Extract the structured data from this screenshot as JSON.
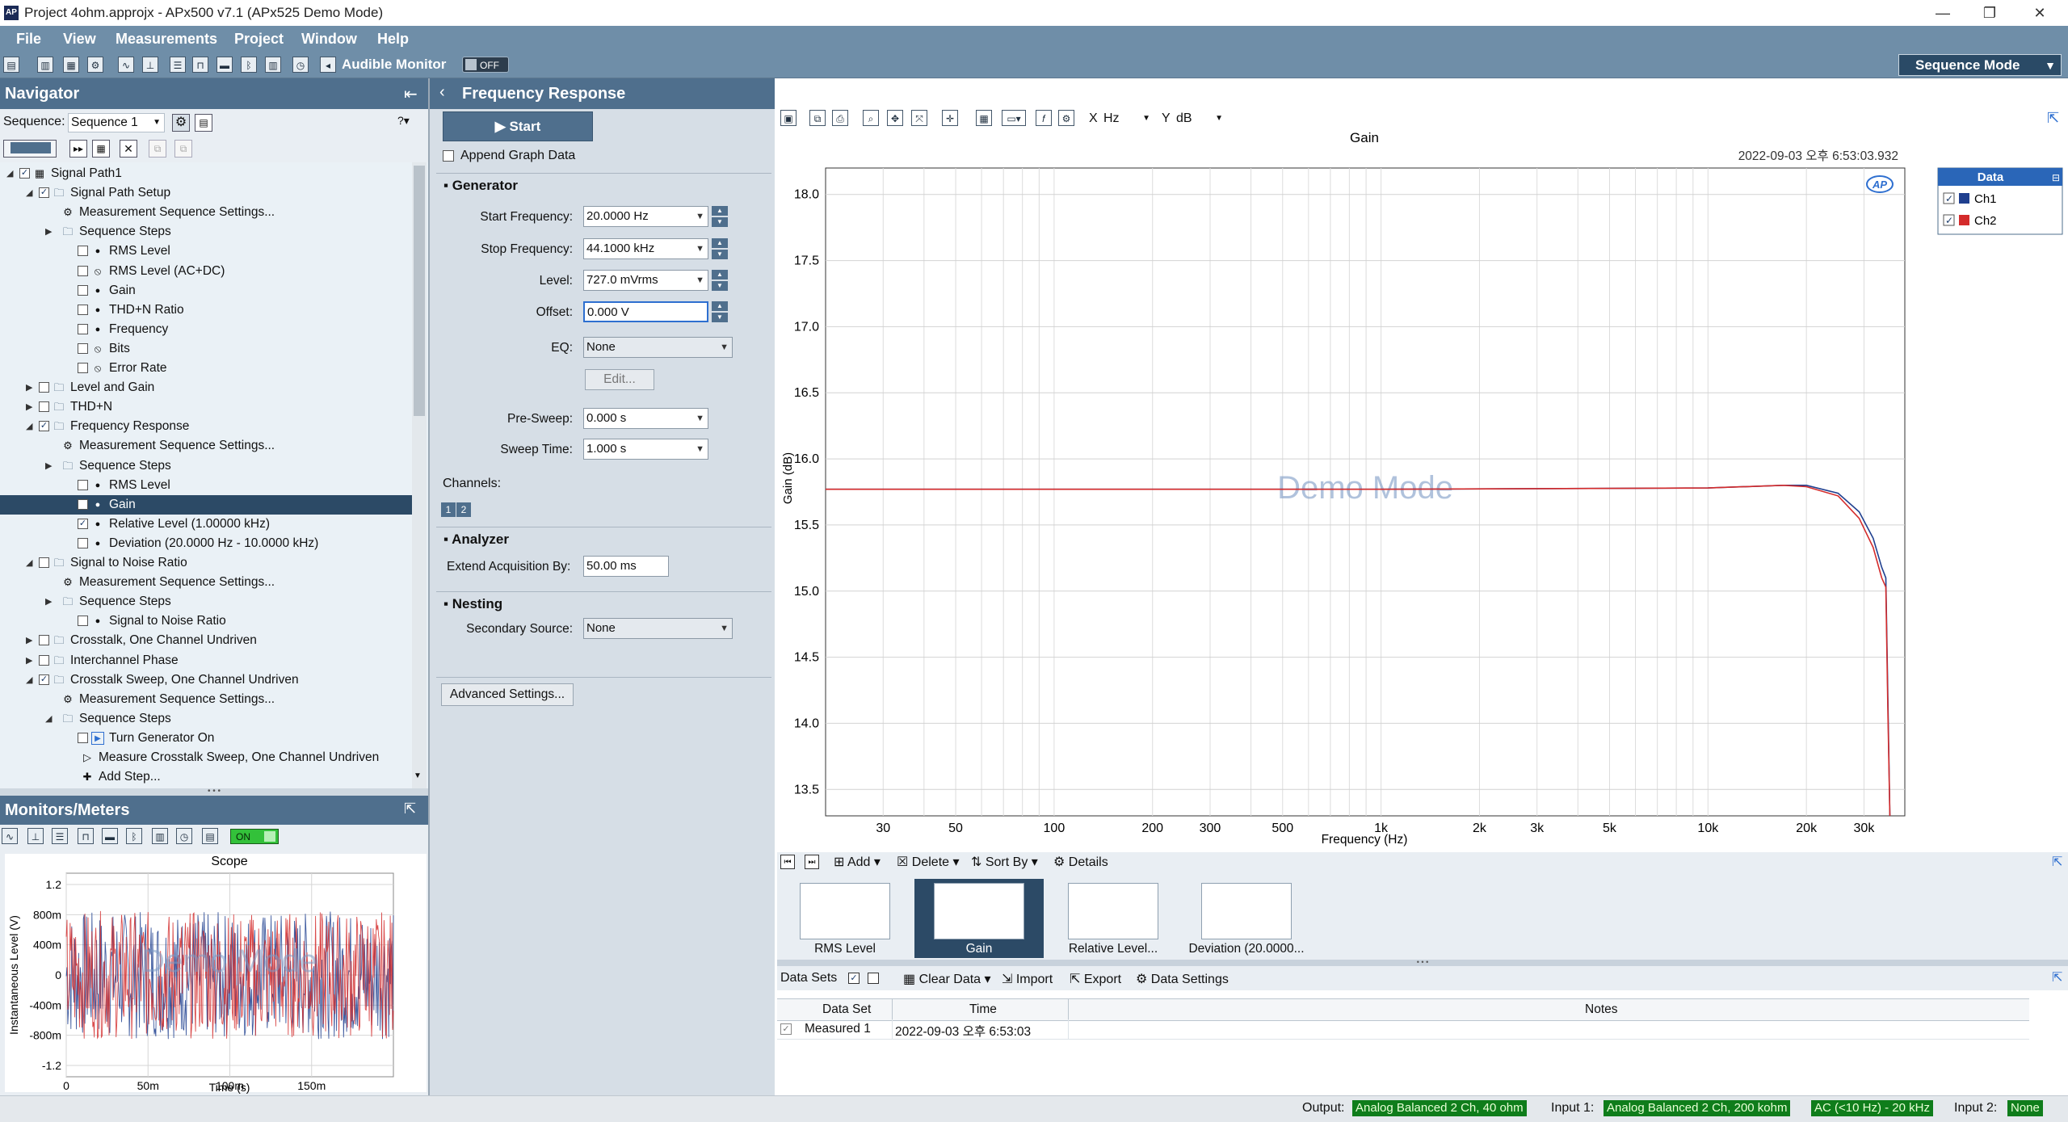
{
  "window": {
    "title": "Project 4ohm.approjx - APx500 v7.1 (APx525 Demo Mode)",
    "controls": [
      "minimize",
      "maximize",
      "close"
    ]
  },
  "menu": [
    "File",
    "View",
    "Measurements",
    "Project",
    "Window",
    "Help"
  ],
  "toolbar": {
    "audible_monitor_label": "Audible Monitor",
    "audible_monitor_state": "OFF",
    "sequence_mode": "Sequence Mode"
  },
  "navigator": {
    "title": "Navigator",
    "sequence_label": "Sequence:",
    "sequence_value": "Sequence 1",
    "tree": [
      {
        "label": "Signal Path1",
        "indent": 0,
        "twisty": "expanded",
        "checked": true,
        "icon": "signal-path-icon"
      },
      {
        "label": "Signal Path Setup",
        "indent": 1,
        "twisty": "expanded",
        "checked": true,
        "icon": "folder-icon"
      },
      {
        "label": "Measurement Sequence Settings...",
        "indent": 2,
        "twisty": "",
        "checked": null,
        "icon": "gear-icon"
      },
      {
        "label": "Sequence Steps",
        "indent": 2,
        "twisty": "collapsed",
        "checked": null,
        "icon": "folder-icon"
      },
      {
        "label": "RMS Level",
        "indent": 3,
        "twisty": "",
        "checked": false,
        "icon": "dot-icon"
      },
      {
        "label": "RMS Level (AC+DC)",
        "indent": 3,
        "twisty": "",
        "checked": false,
        "icon": "disabled-icon"
      },
      {
        "label": "Gain",
        "indent": 3,
        "twisty": "",
        "checked": false,
        "icon": "dot-icon"
      },
      {
        "label": "THD+N Ratio",
        "indent": 3,
        "twisty": "",
        "checked": false,
        "icon": "dot-icon"
      },
      {
        "label": "Frequency",
        "indent": 3,
        "twisty": "",
        "checked": false,
        "icon": "dot-icon"
      },
      {
        "label": "Bits",
        "indent": 3,
        "twisty": "",
        "checked": false,
        "icon": "disabled-icon"
      },
      {
        "label": "Error Rate",
        "indent": 3,
        "twisty": "",
        "checked": false,
        "icon": "disabled-icon"
      },
      {
        "label": "Level and Gain",
        "indent": 1,
        "twisty": "collapsed",
        "checked": false,
        "icon": "folder-icon"
      },
      {
        "label": "THD+N",
        "indent": 1,
        "twisty": "collapsed",
        "checked": false,
        "icon": "folder-icon"
      },
      {
        "label": "Frequency Response",
        "indent": 1,
        "twisty": "expanded",
        "checked": true,
        "icon": "folder-icon"
      },
      {
        "label": "Measurement Sequence Settings...",
        "indent": 2,
        "twisty": "",
        "checked": null,
        "icon": "gear-icon"
      },
      {
        "label": "Sequence Steps",
        "indent": 2,
        "twisty": "collapsed",
        "checked": null,
        "icon": "folder-icon"
      },
      {
        "label": "RMS Level",
        "indent": 3,
        "twisty": "",
        "checked": false,
        "icon": "dot-icon"
      },
      {
        "label": "Gain",
        "indent": 3,
        "twisty": "",
        "checked": false,
        "icon": "dot-icon",
        "selected": true
      },
      {
        "label": "Relative Level (1.00000 kHz)",
        "indent": 3,
        "twisty": "",
        "checked": true,
        "icon": "dot-icon"
      },
      {
        "label": "Deviation (20.0000 Hz - 10.0000 kHz)",
        "indent": 3,
        "twisty": "",
        "checked": false,
        "icon": "dot-icon"
      },
      {
        "label": "Signal to Noise Ratio",
        "indent": 1,
        "twisty": "expanded",
        "checked": false,
        "icon": "folder-icon"
      },
      {
        "label": "Measurement Sequence Settings...",
        "indent": 2,
        "twisty": "",
        "checked": null,
        "icon": "gear-icon"
      },
      {
        "label": "Sequence Steps",
        "indent": 2,
        "twisty": "collapsed",
        "checked": null,
        "icon": "folder-icon"
      },
      {
        "label": "Signal to Noise Ratio",
        "indent": 3,
        "twisty": "",
        "checked": false,
        "icon": "dot-icon"
      },
      {
        "label": "Crosstalk, One Channel Undriven",
        "indent": 1,
        "twisty": "collapsed",
        "checked": false,
        "icon": "folder-icon"
      },
      {
        "label": "Interchannel Phase",
        "indent": 1,
        "twisty": "collapsed",
        "checked": false,
        "icon": "folder-icon"
      },
      {
        "label": "Crosstalk Sweep, One Channel Undriven",
        "indent": 1,
        "twisty": "expanded",
        "checked": true,
        "icon": "folder-icon"
      },
      {
        "label": "Measurement Sequence Settings...",
        "indent": 2,
        "twisty": "",
        "checked": null,
        "icon": "gear-icon"
      },
      {
        "label": "Sequence Steps",
        "indent": 2,
        "twisty": "expanded",
        "checked": null,
        "icon": "folder-icon"
      },
      {
        "label": "Turn Generator On",
        "indent": 3,
        "twisty": "",
        "checked": false,
        "icon": "play-step-icon"
      },
      {
        "label": "Measure Crosstalk Sweep, One Channel Undriven",
        "indent": 3,
        "twisty": "",
        "checked": null,
        "icon": "arrow-step-icon"
      },
      {
        "label": "Add Step...",
        "indent": 3,
        "twisty": "",
        "checked": null,
        "icon": "plus-icon"
      }
    ]
  },
  "monitors": {
    "title": "Monitors/Meters",
    "on_label": "ON",
    "scope": {
      "title": "Scope",
      "xlabel": "Time (s)",
      "ylabel": "Instantaneous Level (V)",
      "watermark": "Demo Mode",
      "yticks": [
        "1.2",
        "800m",
        "400m",
        "0",
        "-400m",
        "-800m",
        "-1.2"
      ],
      "xticks": [
        "0",
        "50m",
        "100m",
        "150m"
      ]
    }
  },
  "frequency_response": {
    "title": "Frequency Response",
    "start_label": "Start",
    "append_graph_data": "Append Graph Data",
    "generator": {
      "section": "Generator",
      "start_frequency_label": "Start Frequency:",
      "start_frequency": "20.0000 Hz",
      "stop_frequency_label": "Stop Frequency:",
      "stop_frequency": "44.1000 kHz",
      "level_label": "Level:",
      "level": "727.0 mVrms",
      "offset_label": "Offset:",
      "offset": "0.000 V",
      "eq_label": "EQ:",
      "eq": "None",
      "edit_label": "Edit...",
      "pre_sweep_label": "Pre-Sweep:",
      "pre_sweep": "0.000 s",
      "sweep_time_label": "Sweep Time:",
      "sweep_time": "1.000 s",
      "channels_label": "Channels:",
      "channels": [
        "1",
        "2"
      ]
    },
    "analyzer": {
      "section": "Analyzer",
      "extend_label": "Extend Acquisition By:",
      "extend_value": "50.00 ms"
    },
    "nesting": {
      "section": "Nesting",
      "secondary_label": "Secondary Source:",
      "secondary_value": "None"
    },
    "advanced_label": "Advanced Settings..."
  },
  "graph": {
    "x_unit_label": "X",
    "x_unit": "Hz",
    "y_unit_label": "Y",
    "y_unit": "dB",
    "timestamp": "2022-09-03 오후 6:53:03.932",
    "watermark": "Demo Mode",
    "legend_title": "Data",
    "colors": {
      "ch1": "#1f3f8f",
      "ch2": "#d42b2b"
    }
  },
  "chart_data": {
    "type": "line",
    "title": "Gain",
    "xlabel": "Frequency (Hz)",
    "ylabel": "Gain (dB)",
    "x_scale": "log",
    "xlim": [
      20,
      40000
    ],
    "ylim": [
      13.3,
      18.2
    ],
    "xticks": [
      30,
      50,
      100,
      200,
      300,
      500,
      1000,
      2000,
      3000,
      5000,
      10000,
      20000,
      30000
    ],
    "xtick_labels": [
      "30",
      "50",
      "100",
      "200",
      "300",
      "500",
      "1k",
      "2k",
      "3k",
      "5k",
      "10k",
      "20k",
      "30k"
    ],
    "yticks": [
      13.5,
      14.0,
      14.5,
      15.0,
      15.5,
      16.0,
      16.5,
      17.0,
      17.5,
      18.0
    ],
    "ytick_labels": [
      "13.5",
      "14.0",
      "14.5",
      "15.0",
      "15.5",
      "16.0",
      "16.5",
      "17.0",
      "17.5",
      "18.0"
    ],
    "grid": true,
    "legend_position": "right",
    "series": [
      {
        "name": "Ch1",
        "color": "#1f3f8f",
        "x": [
          20,
          50,
          100,
          1000,
          10000,
          17000,
          20000,
          25000,
          29000,
          32000,
          34000,
          35000,
          35500,
          36000
        ],
        "y": [
          15.77,
          15.77,
          15.77,
          15.77,
          15.78,
          15.8,
          15.8,
          15.74,
          15.6,
          15.4,
          15.18,
          15.1,
          14.2,
          13.3
        ]
      },
      {
        "name": "Ch2",
        "color": "#d42b2b",
        "x": [
          20,
          50,
          100,
          1000,
          10000,
          17000,
          20000,
          25000,
          29000,
          32000,
          34000,
          35000,
          35500,
          36000
        ],
        "y": [
          15.77,
          15.77,
          15.77,
          15.77,
          15.78,
          15.8,
          15.79,
          15.72,
          15.55,
          15.33,
          15.1,
          15.03,
          14.1,
          13.3
        ]
      }
    ]
  },
  "thumbnails": {
    "add": "Add",
    "delete": "Delete",
    "sort_by": "Sort By",
    "details": "Details",
    "items": [
      "RMS Level",
      "Gain",
      "Relative Level...",
      "Deviation (20.0000..."
    ]
  },
  "datasets": {
    "label": "Data Sets",
    "clear_data": "Clear Data",
    "import": "Import",
    "export": "Export",
    "data_settings": "Data Settings",
    "columns": [
      "Data Set",
      "Time",
      "Notes"
    ],
    "rows": [
      {
        "name": "Measured 1",
        "time": "2022-09-03 오후 6:53:03",
        "notes": ""
      }
    ]
  },
  "status": {
    "output_label": "Output:",
    "output_value": "Analog Balanced 2 Ch, 40 ohm",
    "input1_label": "Input 1:",
    "input1_value": "Analog Balanced 2 Ch, 200 kohm",
    "input1_filter": "AC (<10 Hz) - 20 kHz",
    "input2_label": "Input 2:",
    "input2_value": "None"
  }
}
